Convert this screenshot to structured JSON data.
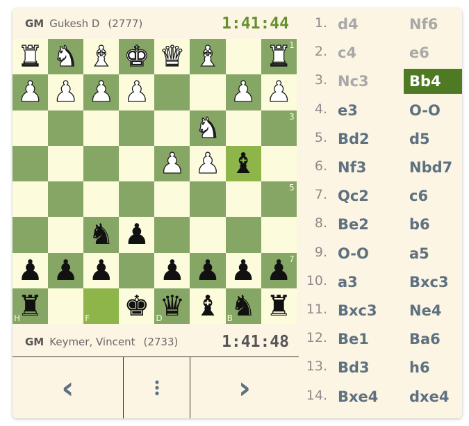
{
  "players": {
    "top": {
      "title": "GM",
      "name": "Gukesh D",
      "rating": "(2777)",
      "clock": "1:41:44"
    },
    "bottom": {
      "title": "GM",
      "name": "Keymer, Vincent",
      "rating": "(2733)",
      "clock": "1:41:48"
    }
  },
  "board": {
    "orientation": "black-bottom",
    "rows": [
      [
        "wR",
        "wN",
        "wB",
        "wK",
        "wQ",
        "wB",
        "",
        "wR"
      ],
      [
        "wP",
        "wP",
        "wP",
        "wP",
        "",
        "",
        "wP",
        "wP"
      ],
      [
        "",
        "",
        "",
        "",
        "",
        "wN",
        "",
        ""
      ],
      [
        "",
        "",
        "",
        "",
        "wP",
        "wP",
        "bB",
        ""
      ],
      [
        "",
        "",
        "",
        "",
        "",
        "",
        "",
        ""
      ],
      [
        "",
        "",
        "bN",
        "bP",
        "",
        "",
        "",
        ""
      ],
      [
        "bP",
        "bP",
        "bP",
        "",
        "bP",
        "bP",
        "bP",
        "bP"
      ],
      [
        "bR",
        "",
        "",
        "bK",
        "bQ",
        "bB",
        "bN",
        "bR"
      ]
    ],
    "highlight": [
      [
        3,
        6
      ],
      [
        7,
        2
      ]
    ],
    "rank_labels": {
      "0": "1",
      "2": "3",
      "4": "5",
      "6": "7"
    },
    "file_labels": {
      "0": "H",
      "2": "F",
      "4": "D",
      "6": "B"
    },
    "colors": {
      "light": "#fcfbdc",
      "dark": "#86a666",
      "highlight": "#8db54a"
    }
  },
  "controls": {
    "prev_icon": "chevron-left-icon",
    "menu_icon": "vertical-dots-icon",
    "next_icon": "chevron-right-icon"
  },
  "moves": [
    {
      "n": "1.",
      "w": "d4",
      "b": "Nf6"
    },
    {
      "n": "2.",
      "w": "c4",
      "b": "e6"
    },
    {
      "n": "3.",
      "w": "Nc3",
      "b": "Bb4"
    },
    {
      "n": "4.",
      "w": "e3",
      "b": "O-O"
    },
    {
      "n": "5.",
      "w": "Bd2",
      "b": "d5"
    },
    {
      "n": "6.",
      "w": "Nf3",
      "b": "Nbd7"
    },
    {
      "n": "7.",
      "w": "Qc2",
      "b": "c6"
    },
    {
      "n": "8.",
      "w": "Be2",
      "b": "b6"
    },
    {
      "n": "9.",
      "w": "O-O",
      "b": "a5"
    },
    {
      "n": "10.",
      "w": "a3",
      "b": "Bxc3"
    },
    {
      "n": "11.",
      "w": "Bxc3",
      "b": "Ne4"
    },
    {
      "n": "12.",
      "w": "Be1",
      "b": "Ba6"
    },
    {
      "n": "13.",
      "w": "Bd3",
      "b": "h6"
    },
    {
      "n": "14.",
      "w": "Bxe4",
      "b": "dxe4"
    }
  ],
  "current_move": {
    "index": 2,
    "side": "b"
  },
  "accent_color": "#4d7a22"
}
